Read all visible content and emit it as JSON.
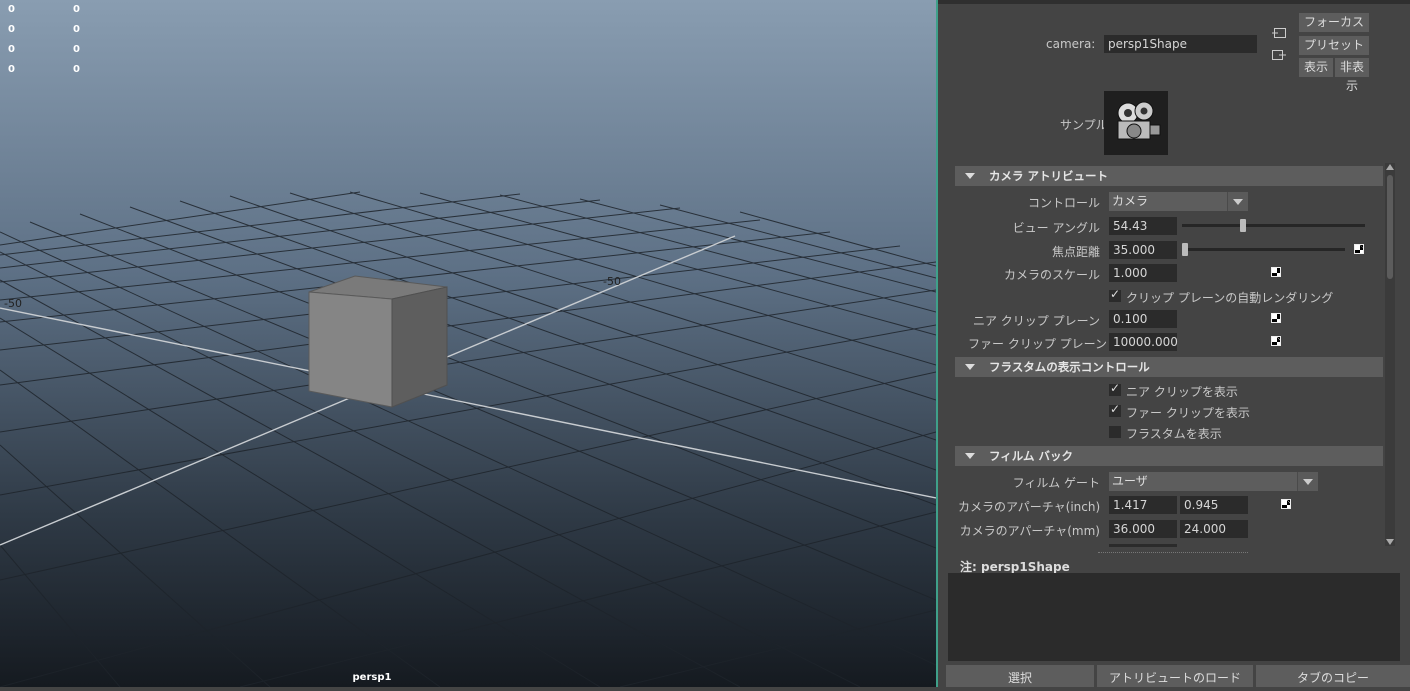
{
  "viewport": {
    "camera_name": "persp1",
    "hud_rows": [
      [
        "0",
        "0"
      ],
      [
        "0",
        "0"
      ],
      [
        "0",
        "0"
      ],
      [
        "0",
        "0"
      ]
    ],
    "grid_label_left": "-50",
    "grid_label_mid": "-50"
  },
  "panel": {
    "camera_label": "camera:",
    "camera_value": "persp1Shape",
    "focus_button": "フォーカス",
    "preset_button": "プリセット",
    "show_button": "表示",
    "hide_button": "非表示",
    "sample_label": "サンプル",
    "sections": {
      "camera_attributes": "カメラ アトリビュート",
      "frustum_display": "フラスタムの表示コントロール",
      "film_back": "フィルム バック"
    },
    "camera_attributes": {
      "control_label": "コントロール",
      "control_value": "カメラ",
      "view_angle_label": "ビュー アングル",
      "view_angle_value": "54.43",
      "view_angle_slider": 0.33,
      "focal_length_label": "焦点距離",
      "focal_length_value": "35.000",
      "focal_length_slider": 0.0,
      "camera_scale_label": "カメラのスケール",
      "camera_scale_value": "1.000",
      "auto_render_clip_label": "クリップ プレーンの自動レンダリング",
      "auto_render_clip_checked": true,
      "near_clip_label": "ニア クリップ プレーン",
      "near_clip_value": "0.100",
      "far_clip_label": "ファー クリップ プレーン",
      "far_clip_value": "10000.000"
    },
    "frustum": {
      "near_clip_label": "ニア クリップを表示",
      "near_clip_checked": true,
      "far_clip_label": "ファー クリップを表示",
      "far_clip_checked": true,
      "frustum_label": "フラスタムを表示",
      "frustum_checked": false
    },
    "film_back": {
      "film_gate_label": "フィルム ゲート",
      "film_gate_value": "ユーザ",
      "aperture_inch_label": "カメラのアパーチャ(inch)",
      "aperture_inch_x": "1.417",
      "aperture_inch_y": "0.945",
      "aperture_mm_label": "カメラのアパーチャ(mm)",
      "aperture_mm_x": "36.000",
      "aperture_mm_y": "24.000"
    },
    "notes_label": "注:  persp1Shape",
    "bottom_buttons": {
      "select": "選択",
      "load_attributes": "アトリビュートのロード",
      "copy_tab": "タブのコピー"
    }
  }
}
